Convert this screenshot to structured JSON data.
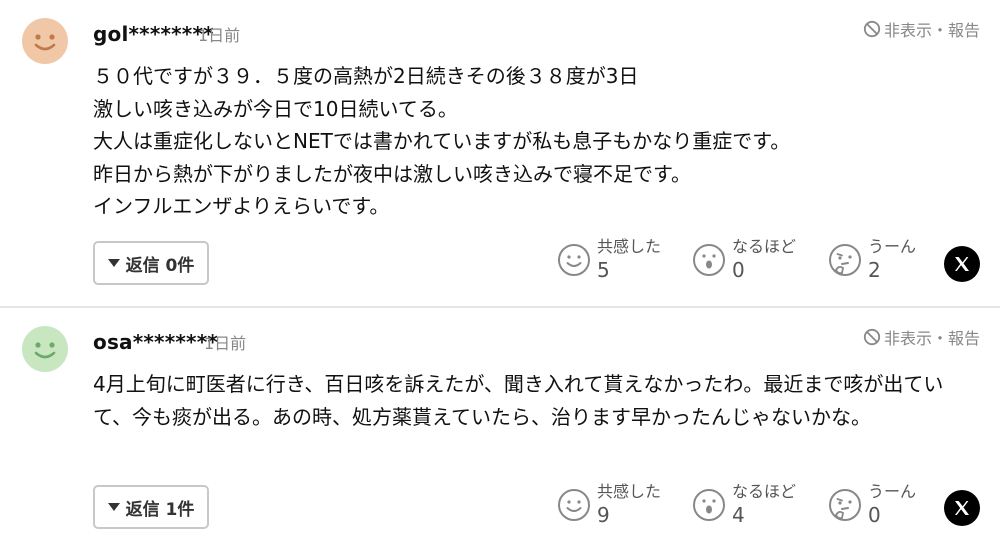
{
  "colors": {
    "avatar_orange": "#f0c8a8",
    "avatar_green": "#c8e6c0",
    "text": "#111111",
    "muted": "#888888",
    "divider": "#e6e6e6"
  },
  "comments": [
    {
      "username": "gol********",
      "time": "1日前",
      "report_label": "非表示・報告",
      "body": [
        "５０代ですが３９．５度の高熱が2日続きその後３８度が3日",
        "激しい咳き込みが今日で10日続いてる。",
        "大人は重症化しないとNETでは書かれていますが私も息子もかなり重症です。",
        "昨日から熱が下がりましたが夜中は激しい咳き込みで寝不足です。",
        "インフルエンザよりえらいです。"
      ],
      "reply_label": "返信 0件",
      "reactions": [
        {
          "icon": "smile-face-icon",
          "label": "共感した",
          "count": "5"
        },
        {
          "icon": "surprised-face-icon",
          "label": "なるほど",
          "count": "0"
        },
        {
          "icon": "thinking-face-icon",
          "label": "うーん",
          "count": "2"
        }
      ]
    },
    {
      "username": "osa********",
      "time": "1日前",
      "report_label": "非表示・報告",
      "body": [
        "4月上旬に町医者に行き、百日咳を訴えたが、聞き入れて貰えなかったわ。最近まで咳が出ていて、今も痰が出る。あの時、処方薬貰えていたら、治ります早かったんじゃないかな。"
      ],
      "reply_label": "返信 1件",
      "reactions": [
        {
          "icon": "smile-face-icon",
          "label": "共感した",
          "count": "9"
        },
        {
          "icon": "surprised-face-icon",
          "label": "なるほど",
          "count": "4"
        },
        {
          "icon": "thinking-face-icon",
          "label": "うーん",
          "count": "0"
        }
      ]
    }
  ]
}
